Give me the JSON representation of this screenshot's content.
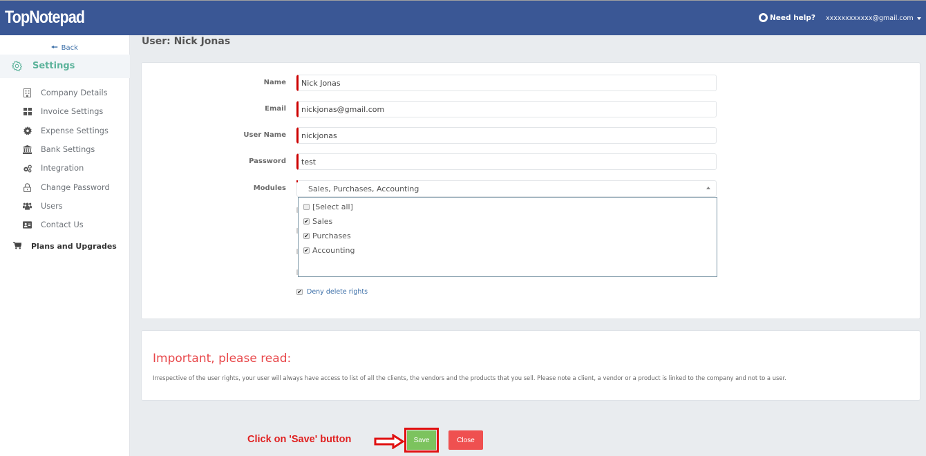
{
  "header": {
    "logo": "TopNotepad",
    "help_label": "Need help?",
    "account_email": "xxxxxxxxxxxx@gmail.com",
    "bg_color": "#3a5795"
  },
  "sidebar": {
    "back_label": "Back",
    "section_label": "Settings",
    "items": [
      {
        "label": "Company Details",
        "icon": "building-icon"
      },
      {
        "label": "Invoice Settings",
        "icon": "grid-icon"
      },
      {
        "label": "Expense Settings",
        "icon": "cog-icon"
      },
      {
        "label": "Bank Settings",
        "icon": "bank-icon"
      },
      {
        "label": "Integration",
        "icon": "cogs-icon"
      },
      {
        "label": "Change Password",
        "icon": "lock-icon"
      },
      {
        "label": "Users",
        "icon": "users-icon"
      },
      {
        "label": "Contact Us",
        "icon": "contact-card-icon"
      }
    ],
    "plans_label": "Plans and Upgrades"
  },
  "page": {
    "title": "User: Nick Jonas"
  },
  "form": {
    "name": {
      "label": "Name",
      "value": "Nick Jonas"
    },
    "email": {
      "label": "Email",
      "value": "nickjonas@gmail.com"
    },
    "username": {
      "label": "User Name",
      "value": "nickjonas"
    },
    "password": {
      "label": "Password",
      "value": "test"
    },
    "modules": {
      "label": "Modules",
      "selected": "Sales, Purchases, Accounting",
      "options": [
        {
          "label": "[Select all]",
          "checked": false
        },
        {
          "label": "Sales",
          "checked": true
        },
        {
          "label": "Purchases",
          "checked": true
        },
        {
          "label": "Accounting",
          "checked": true
        }
      ]
    },
    "deny_delete": {
      "label": "Deny delete rights",
      "checked": true
    }
  },
  "info": {
    "title": "Important, please read:",
    "text": "Irrespective of the user rights, your user will always have access to list of all the clients, the vendors and the products that you sell. Please note a client, a vendor or a product is linked to the company and not to a user."
  },
  "actions": {
    "annotation": "Click on 'Save' button",
    "save_label": "Save",
    "close_label": "Close",
    "save_color": "#7cc35e",
    "close_color": "#ef5050"
  }
}
